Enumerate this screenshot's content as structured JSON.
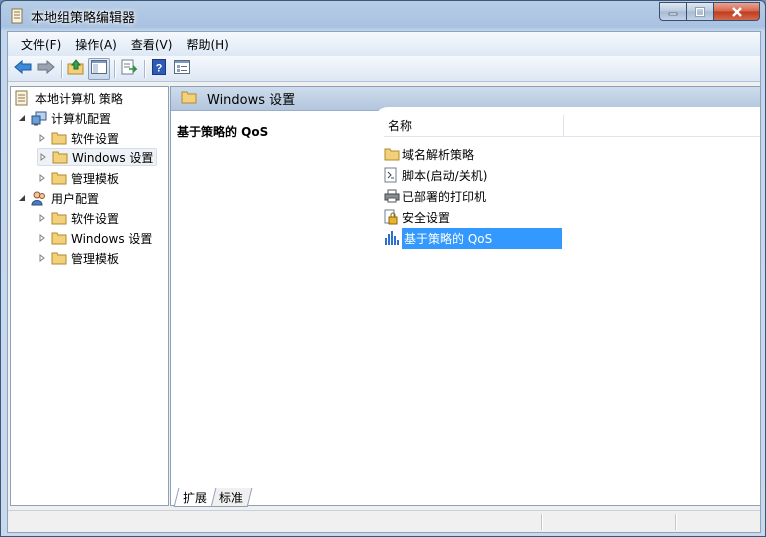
{
  "window": {
    "title": "本地组策略编辑器"
  },
  "menu": {
    "items": [
      "文件(F)",
      "操作(A)",
      "查看(V)",
      "帮助(H)"
    ]
  },
  "toolbar": {
    "buttons": [
      "back-icon",
      "forward-icon",
      "up-folder-icon",
      "show-hide-tree-icon",
      "export-list-icon",
      "help-icon",
      "properties-view-icon"
    ]
  },
  "tree": {
    "root": "本地计算机 策略",
    "computer_config": "计算机配置",
    "computer_children": [
      "软件设置",
      "Windows 设置",
      "管理模板"
    ],
    "user_config": "用户配置",
    "user_children": [
      "软件设置",
      "Windows 设置",
      "管理模板"
    ]
  },
  "right_pane": {
    "header": "Windows 设置",
    "description_title": "基于策略的 QoS",
    "column_name": "名称",
    "items": [
      {
        "label": "域名解析策略",
        "icon": "folder-icon"
      },
      {
        "label": "脚本(启动/关机)",
        "icon": "script-icon"
      },
      {
        "label": "已部署的打印机",
        "icon": "printer-icon"
      },
      {
        "label": "安全设置",
        "icon": "security-icon"
      },
      {
        "label": "基于策略的 QoS",
        "icon": "qos-chart-icon"
      }
    ],
    "selected_index": 4
  },
  "tabs": [
    "扩展",
    "标准"
  ],
  "colors": {
    "selection": "#3399ff",
    "header_gradient": "#b2c6dd",
    "folder": "#f3d07a"
  }
}
